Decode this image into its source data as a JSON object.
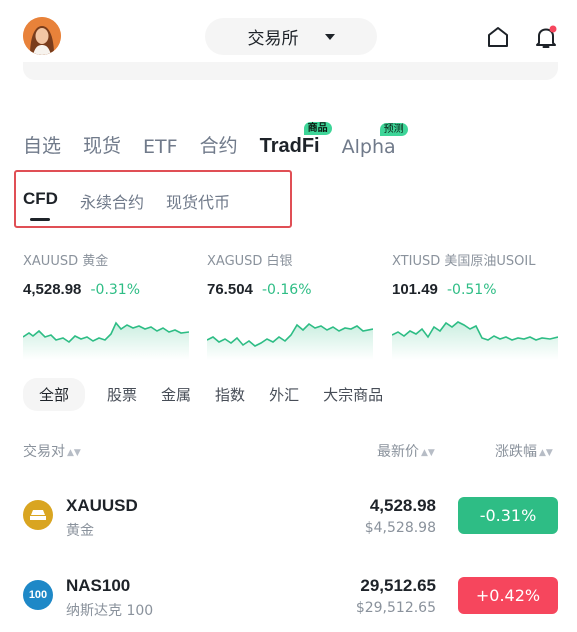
{
  "header": {
    "exchange_label": "交易所",
    "avatar": "avatar",
    "right_icons": [
      "home-icon",
      "bell-icon"
    ],
    "notification_dot_color": "#f6465d"
  },
  "market_tabs": [
    {
      "label": "自选",
      "active": false
    },
    {
      "label": "现货",
      "active": false
    },
    {
      "label": "ETF",
      "active": false
    },
    {
      "label": "合约",
      "active": false
    },
    {
      "label": "TradFi",
      "active": true,
      "tag": "商品"
    },
    {
      "label": "Alpha",
      "active": false,
      "tag": "预测"
    }
  ],
  "sub_tabs": [
    {
      "label": "CFD",
      "active": true
    },
    {
      "label": "永续合约",
      "active": false
    },
    {
      "label": "现货代币",
      "active": false
    }
  ],
  "tickers": [
    {
      "symbol": "XAUUSD 黄金",
      "price": "4,528.98",
      "change": "-0.31%"
    },
    {
      "symbol": "XAGUSD 白银",
      "price": "76.504",
      "change": "-0.16%"
    },
    {
      "symbol": "XTIUSD 美国原油USOIL",
      "price": "101.49",
      "change": "-0.51%"
    }
  ],
  "categories": [
    "全部",
    "股票",
    "金属",
    "指数",
    "外汇",
    "大宗商品"
  ],
  "list_header": {
    "pair": "交易对",
    "last_price": "最新价",
    "change": "涨跌幅"
  },
  "rows": [
    {
      "symbol": "XAUUSD",
      "name": "黄金",
      "price": "4,528.98",
      "price_sub": "$4,528.98",
      "change": "-0.31%",
      "icon_color": "#d9a521"
    },
    {
      "symbol": "NAS100",
      "name": "纳斯达克 100",
      "price": "29,512.65",
      "price_sub": "$29,512.65",
      "change": "+0.42%",
      "icon_text": "100",
      "icon_color": "#1e88c7"
    }
  ],
  "colors": {
    "up": "#f6465d",
    "down": "#2ebd85",
    "highlight_box": "#e04f55"
  }
}
